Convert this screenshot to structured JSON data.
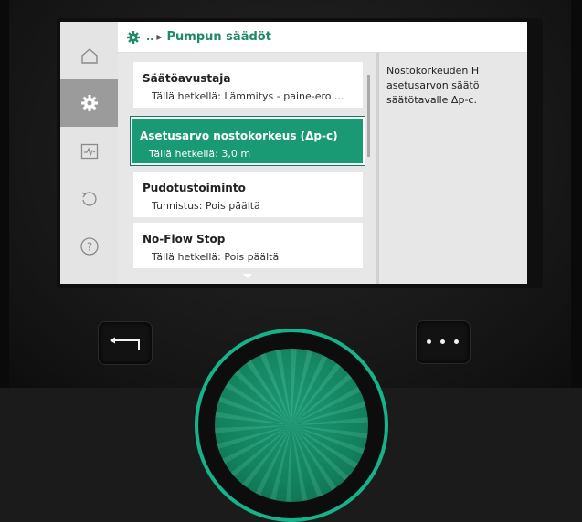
{
  "header": {
    "breadcrumb": "..",
    "title": "Pumpun säädöt"
  },
  "sidebar": {
    "items": [
      {
        "icon": "home-icon",
        "active": false
      },
      {
        "icon": "gear-icon",
        "active": true
      },
      {
        "icon": "diagnostics-icon",
        "active": false
      },
      {
        "icon": "restore-icon",
        "active": false
      },
      {
        "icon": "help-icon",
        "active": false
      }
    ]
  },
  "list": {
    "items": [
      {
        "title": "Säätöavustaja",
        "subtitle": "Tällä hetkellä: Lämmitys - paine-ero ..."
      },
      {
        "title": "Asetusarvo nostokorkeus (Δp-c)",
        "subtitle": "Tällä hetkellä: 3,0 m"
      },
      {
        "title": "Pudotustoiminto",
        "subtitle": "Tunnistus: Pois päältä"
      },
      {
        "title": "No-Flow Stop",
        "subtitle": "Tällä hetkellä: Pois päältä"
      }
    ],
    "selected_index": 1
  },
  "help": {
    "text": "Nostokorkeuden H asetusarvon säätö säätötavalle Δp-c."
  },
  "colors": {
    "accent": "#1a9a74",
    "header_text": "#1f8a63",
    "knob_ring": "#16b38a"
  }
}
